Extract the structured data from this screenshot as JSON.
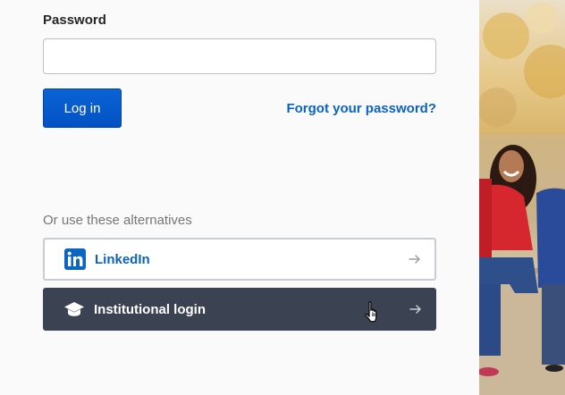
{
  "password": {
    "label": "Password",
    "value": "",
    "placeholder": ""
  },
  "actions": {
    "login_label": "Log in",
    "forgot_label": "Forgot your password?"
  },
  "alternatives": {
    "heading": "Or use these alternatives",
    "options": [
      {
        "label": "LinkedIn",
        "icon": "linkedin-icon",
        "arrow_icon": "arrow-right-icon"
      },
      {
        "label": "Institutional login",
        "icon": "graduation-cap-icon",
        "arrow_icon": "arrow-right-icon"
      }
    ]
  },
  "colors": {
    "primary": "#0352c4",
    "link": "#0a63c4",
    "institutional_bg": "#3b4252",
    "linkedin_brand": "#0a66c2"
  }
}
